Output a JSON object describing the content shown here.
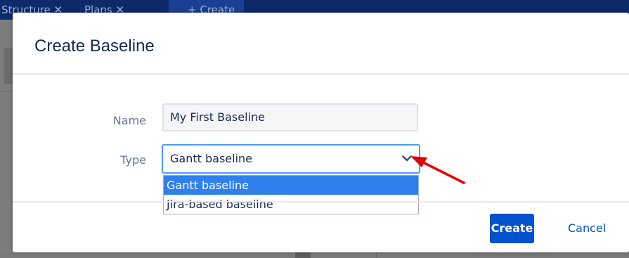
{
  "background": {
    "tabs": [
      {
        "label": "Structure ✕"
      },
      {
        "label": "Plans ✕"
      },
      {
        "label": "+ Create"
      }
    ]
  },
  "dialog": {
    "title": "Create Baseline",
    "name_field": {
      "label": "Name",
      "value": "My First Baseline"
    },
    "type_field": {
      "label": "Type",
      "selected": "Gantt baseline",
      "options": [
        "Gantt baseline",
        "Jira-based baseline"
      ]
    },
    "buttons": {
      "create": "Create",
      "cancel": "Cancel"
    }
  },
  "colors": {
    "primary": "#0052cc",
    "focus": "#4c9aff",
    "option_selected": "#2f80ed",
    "annotation_arrow": "#e60000"
  },
  "icons": {
    "select_chevron": "chevron-down-icon",
    "annotation": "red-arrow-icon"
  }
}
